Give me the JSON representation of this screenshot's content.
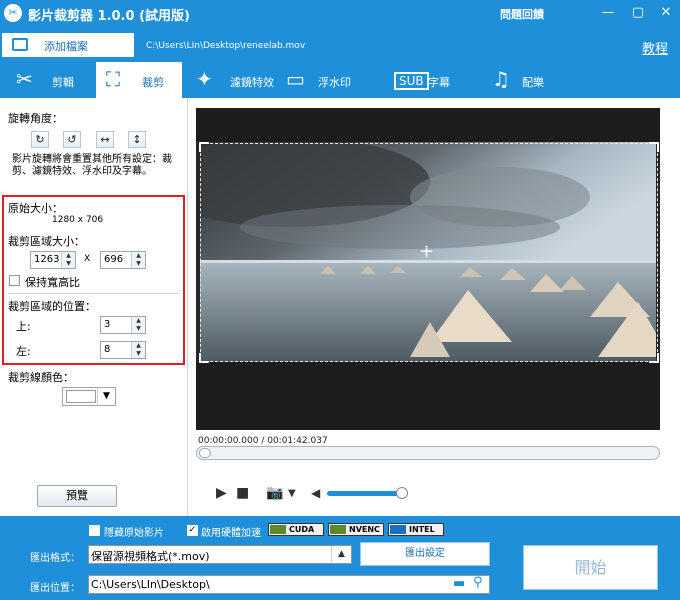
{
  "window": {
    "title": "影片裁剪器 1.0.0 (試用版)",
    "feedback": "問題回饋",
    "app_icon": "scissors-icon"
  },
  "topbar": {
    "add_file": "添加檔案",
    "file_path": "C:\\Users\\LIn\\Desktop\\reneelab.mov",
    "tutorial": "教程"
  },
  "tabs": [
    {
      "label": "剪輯",
      "icon": "scissors-icon"
    },
    {
      "label": "裁剪",
      "icon": "crop-icon"
    },
    {
      "label": "濾鏡特效",
      "icon": "magic-wand-icon"
    },
    {
      "label": "浮水印",
      "icon": "watermark-icon"
    },
    {
      "label": "字幕",
      "icon": "subtitle-icon"
    },
    {
      "label": "配樂",
      "icon": "music-note-icon"
    }
  ],
  "left": {
    "rotate_label": "旋轉角度：",
    "rotate_note": "影片旋轉將會重置其他所有設定：裁剪、濾鏡特效、浮水印及字幕。",
    "original_size_label": "原始大小：",
    "original_size": "1280 x 706",
    "crop_size_label": "裁剪區域大小：",
    "width": "1263",
    "height": "696",
    "times": "X",
    "keep_ratio": "保持寬高比",
    "position_label": "裁剪區域的位置：",
    "top_label": "上:",
    "top_value": "3",
    "left_label": "左:",
    "left_value": "8",
    "line_color_label": "裁剪線顏色：",
    "line_color": "#ffffff",
    "preview": "預覽"
  },
  "player": {
    "time": "00:00:00.000 / 00:01:42.037",
    "progress": 0.0
  },
  "bottom": {
    "hide_original": "隱藏原始影片",
    "hw_accel": "啟用硬體加速",
    "hw_accel_checked": true,
    "cuda": "CUDA",
    "nvenc": "NVENC",
    "intel": "INTEL",
    "format_label": "匯出格式：",
    "format_value": "保留源視頻格式(*.mov)",
    "settings": "匯出設定",
    "location_label": "匯出位置：",
    "location_value": "C:\\Users\\LIn\\Desktop\\",
    "start": "開始"
  },
  "colors": {
    "accent": "#1e8fd8",
    "highlight": "#e02020"
  }
}
